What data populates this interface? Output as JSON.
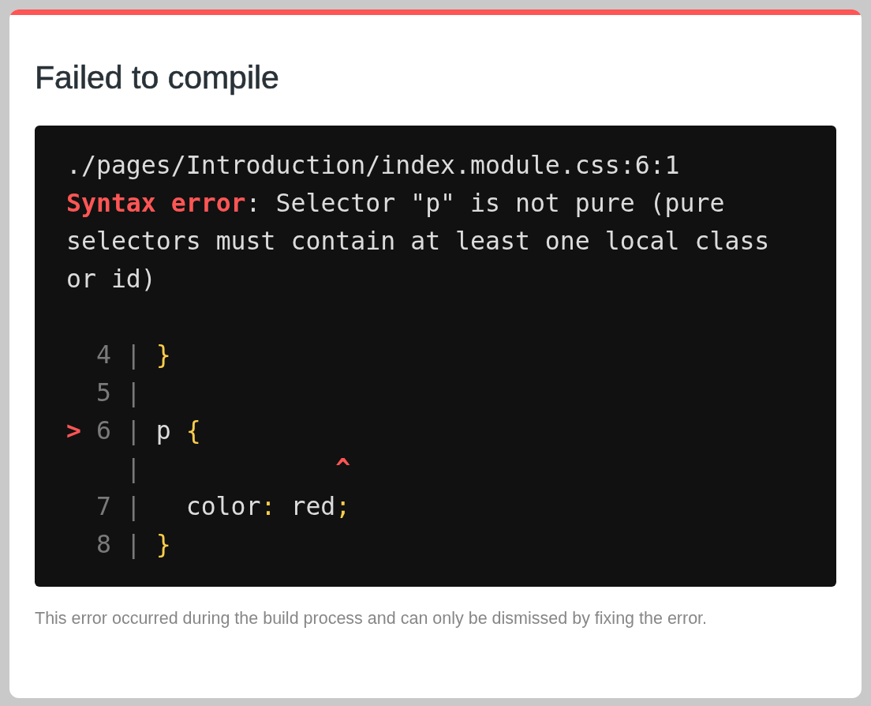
{
  "dialog": {
    "title": "Failed to compile",
    "error": {
      "file": "./pages/Introduction/index.module.css:6:1",
      "message": [
        {
          "text": "Syntax error",
          "kind": "error"
        },
        {
          "text": ": Selector \"p\" is not pure (pure selectors must contain at least one local class or id)",
          "kind": "plain"
        }
      ],
      "code_frame": [
        {
          "number": "4",
          "gutter": "|",
          "segments": [
            {
              "text": "}",
              "kind": "punct"
            }
          ]
        },
        {
          "number": "5",
          "gutter": "|"
        },
        {
          "marker": ">",
          "number": "6",
          "gutter": "|",
          "segments": [
            {
              "text": "p ",
              "kind": "plain"
            },
            {
              "text": "{",
              "kind": "punct"
            }
          ]
        },
        {
          "gutter": "|",
          "segments": [
            {
              "text": "            ^",
              "kind": "error"
            }
          ]
        },
        {
          "number": "7",
          "gutter": "|",
          "segments": [
            {
              "text": "  color",
              "kind": "plain"
            },
            {
              "text": ":",
              "kind": "punct"
            },
            {
              "text": " red",
              "kind": "plain"
            },
            {
              "text": ";",
              "kind": "punct"
            }
          ]
        },
        {
          "number": "8",
          "gutter": "|",
          "segments": [
            {
              "text": "}",
              "kind": "punct"
            }
          ]
        }
      ]
    },
    "footer": "This error occurred during the build process and can only be dismissed by fixing the error."
  }
}
